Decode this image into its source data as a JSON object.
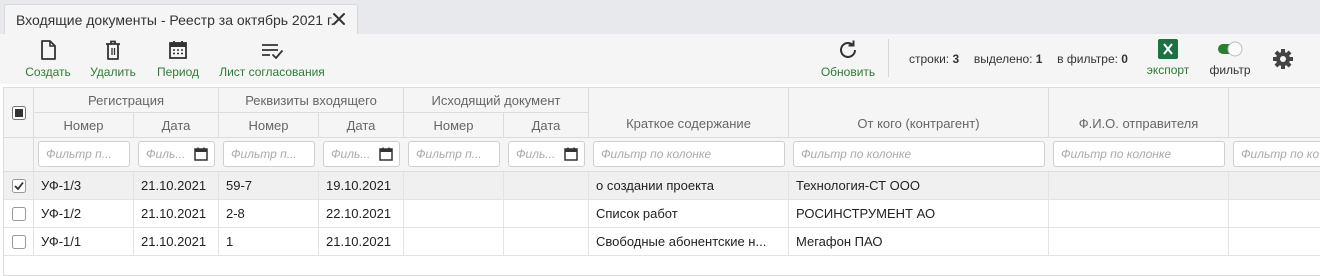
{
  "tab": {
    "title": "Входящие документы - Реестр за октябрь 2021 г."
  },
  "toolbar": {
    "create_label": "Создать",
    "delete_label": "Удалить",
    "period_label": "Период",
    "approval_label": "Лист согласования",
    "refresh_label": "Обновить",
    "export_label": "экспорт",
    "filter_label": "фильтр",
    "filter_toggle_on": true,
    "accent_color": "#2e7d32",
    "excel_color": "#1e7145"
  },
  "stats": {
    "rows_label": "строки:",
    "rows_value": "3",
    "selected_label": "выделено:",
    "selected_value": "1",
    "in_filter_label": "в фильтре:",
    "in_filter_value": "0"
  },
  "groups": {
    "registration": "Регистрация",
    "incoming": "Реквизиты входящего",
    "outgoing": "Исходящий документ"
  },
  "columns": {
    "reg_number": "Номер",
    "reg_date": "Дата",
    "in_number": "Номер",
    "in_date": "Дата",
    "out_number": "Номер",
    "out_date": "Дата",
    "summary": "Краткое содержание",
    "sender": "От кого (контрагент)",
    "sender_name": "Ф.И.О. отправителя"
  },
  "filters": {
    "short": "Фильтр п...",
    "date": "Филь...",
    "full": "Фильтр по колонке",
    "cut": "Фильтр по ко"
  },
  "rows": [
    {
      "checked": true,
      "reg_number": "УФ-1/3",
      "reg_date": "21.10.2021",
      "in_number": "59-7",
      "in_date": "19.10.2021",
      "out_number": "",
      "out_date": "",
      "summary": "о создании проекта",
      "sender": "Технология-СТ ООО",
      "sender_name": ""
    },
    {
      "checked": false,
      "reg_number": "УФ-1/2",
      "reg_date": "21.10.2021",
      "in_number": "2-8",
      "in_date": "22.10.2021",
      "out_number": "",
      "out_date": "",
      "summary": "Список работ",
      "sender": "РОСИНСТРУМЕНТ АО",
      "sender_name": ""
    },
    {
      "checked": false,
      "reg_number": "УФ-1/1",
      "reg_date": "21.10.2021",
      "in_number": "1",
      "in_date": "21.10.2021",
      "out_number": "",
      "out_date": "",
      "summary": "Свободные абонентские н...",
      "sender": "Мегафон ПАО",
      "sender_name": ""
    }
  ]
}
